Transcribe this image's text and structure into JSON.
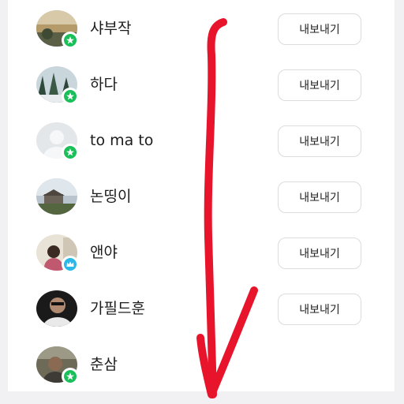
{
  "members": [
    {
      "name": "샤부작",
      "badge": "star-badge",
      "badge_color": "#1bbf5a",
      "export_label": "내보내기"
    },
    {
      "name": "하다",
      "badge": "star-badge",
      "badge_color": "#1bbf5a",
      "export_label": "내보내기"
    },
    {
      "name": "to ma to",
      "badge": "star-badge",
      "badge_color": "#1bbf5a",
      "export_label": "내보내기"
    },
    {
      "name": "논띵이",
      "badge": "star-badge",
      "badge_color": "#1bbf5a",
      "export_label": "내보내기"
    },
    {
      "name": "앤야",
      "badge": "crown-badge",
      "badge_color": "#2bb8e8",
      "export_label": "내보내기"
    },
    {
      "name": "가필드훈",
      "badge": "none",
      "export_label": "내보내기"
    },
    {
      "name": "춘삼",
      "badge": "star-badge",
      "badge_color": "#1bbf5a",
      "export_label": ""
    }
  ],
  "annotation": {
    "shape": "hand-drawn down arrow",
    "color": "#e8142c"
  }
}
